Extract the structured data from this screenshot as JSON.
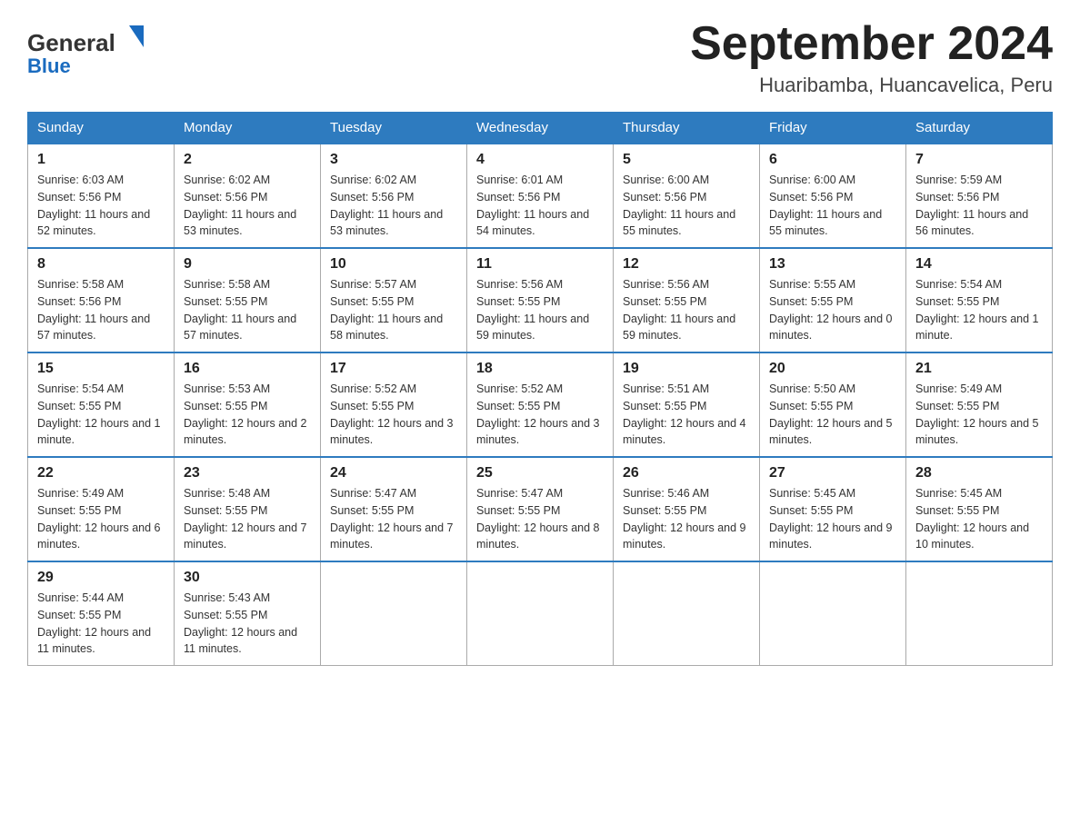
{
  "header": {
    "logo_general": "General",
    "logo_blue": "Blue",
    "title": "September 2024",
    "subtitle": "Huaribamba, Huancavelica, Peru"
  },
  "days_of_week": [
    "Sunday",
    "Monday",
    "Tuesday",
    "Wednesday",
    "Thursday",
    "Friday",
    "Saturday"
  ],
  "weeks": [
    [
      {
        "day": "1",
        "sunrise": "6:03 AM",
        "sunset": "5:56 PM",
        "daylight": "11 hours and 52 minutes."
      },
      {
        "day": "2",
        "sunrise": "6:02 AM",
        "sunset": "5:56 PM",
        "daylight": "11 hours and 53 minutes."
      },
      {
        "day": "3",
        "sunrise": "6:02 AM",
        "sunset": "5:56 PM",
        "daylight": "11 hours and 53 minutes."
      },
      {
        "day": "4",
        "sunrise": "6:01 AM",
        "sunset": "5:56 PM",
        "daylight": "11 hours and 54 minutes."
      },
      {
        "day": "5",
        "sunrise": "6:00 AM",
        "sunset": "5:56 PM",
        "daylight": "11 hours and 55 minutes."
      },
      {
        "day": "6",
        "sunrise": "6:00 AM",
        "sunset": "5:56 PM",
        "daylight": "11 hours and 55 minutes."
      },
      {
        "day": "7",
        "sunrise": "5:59 AM",
        "sunset": "5:56 PM",
        "daylight": "11 hours and 56 minutes."
      }
    ],
    [
      {
        "day": "8",
        "sunrise": "5:58 AM",
        "sunset": "5:56 PM",
        "daylight": "11 hours and 57 minutes."
      },
      {
        "day": "9",
        "sunrise": "5:58 AM",
        "sunset": "5:55 PM",
        "daylight": "11 hours and 57 minutes."
      },
      {
        "day": "10",
        "sunrise": "5:57 AM",
        "sunset": "5:55 PM",
        "daylight": "11 hours and 58 minutes."
      },
      {
        "day": "11",
        "sunrise": "5:56 AM",
        "sunset": "5:55 PM",
        "daylight": "11 hours and 59 minutes."
      },
      {
        "day": "12",
        "sunrise": "5:56 AM",
        "sunset": "5:55 PM",
        "daylight": "11 hours and 59 minutes."
      },
      {
        "day": "13",
        "sunrise": "5:55 AM",
        "sunset": "5:55 PM",
        "daylight": "12 hours and 0 minutes."
      },
      {
        "day": "14",
        "sunrise": "5:54 AM",
        "sunset": "5:55 PM",
        "daylight": "12 hours and 1 minute."
      }
    ],
    [
      {
        "day": "15",
        "sunrise": "5:54 AM",
        "sunset": "5:55 PM",
        "daylight": "12 hours and 1 minute."
      },
      {
        "day": "16",
        "sunrise": "5:53 AM",
        "sunset": "5:55 PM",
        "daylight": "12 hours and 2 minutes."
      },
      {
        "day": "17",
        "sunrise": "5:52 AM",
        "sunset": "5:55 PM",
        "daylight": "12 hours and 3 minutes."
      },
      {
        "day": "18",
        "sunrise": "5:52 AM",
        "sunset": "5:55 PM",
        "daylight": "12 hours and 3 minutes."
      },
      {
        "day": "19",
        "sunrise": "5:51 AM",
        "sunset": "5:55 PM",
        "daylight": "12 hours and 4 minutes."
      },
      {
        "day": "20",
        "sunrise": "5:50 AM",
        "sunset": "5:55 PM",
        "daylight": "12 hours and 5 minutes."
      },
      {
        "day": "21",
        "sunrise": "5:49 AM",
        "sunset": "5:55 PM",
        "daylight": "12 hours and 5 minutes."
      }
    ],
    [
      {
        "day": "22",
        "sunrise": "5:49 AM",
        "sunset": "5:55 PM",
        "daylight": "12 hours and 6 minutes."
      },
      {
        "day": "23",
        "sunrise": "5:48 AM",
        "sunset": "5:55 PM",
        "daylight": "12 hours and 7 minutes."
      },
      {
        "day": "24",
        "sunrise": "5:47 AM",
        "sunset": "5:55 PM",
        "daylight": "12 hours and 7 minutes."
      },
      {
        "day": "25",
        "sunrise": "5:47 AM",
        "sunset": "5:55 PM",
        "daylight": "12 hours and 8 minutes."
      },
      {
        "day": "26",
        "sunrise": "5:46 AM",
        "sunset": "5:55 PM",
        "daylight": "12 hours and 9 minutes."
      },
      {
        "day": "27",
        "sunrise": "5:45 AM",
        "sunset": "5:55 PM",
        "daylight": "12 hours and 9 minutes."
      },
      {
        "day": "28",
        "sunrise": "5:45 AM",
        "sunset": "5:55 PM",
        "daylight": "12 hours and 10 minutes."
      }
    ],
    [
      {
        "day": "29",
        "sunrise": "5:44 AM",
        "sunset": "5:55 PM",
        "daylight": "12 hours and 11 minutes."
      },
      {
        "day": "30",
        "sunrise": "5:43 AM",
        "sunset": "5:55 PM",
        "daylight": "12 hours and 11 minutes."
      },
      null,
      null,
      null,
      null,
      null
    ]
  ],
  "labels": {
    "sunrise": "Sunrise:",
    "sunset": "Sunset:",
    "daylight": "Daylight:"
  }
}
